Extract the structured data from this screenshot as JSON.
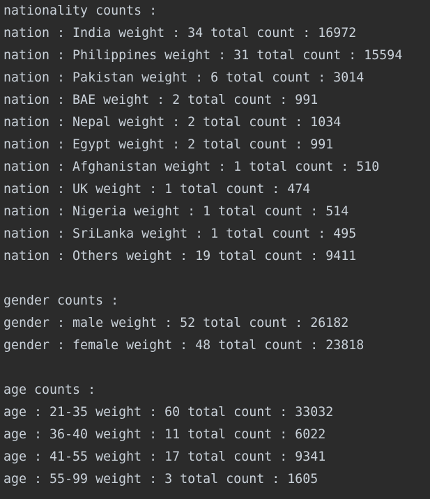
{
  "theme": {
    "background": "#2b2b2b",
    "text_color": "#c9d1d9"
  },
  "output": {
    "nationality_header": "nationality counts :",
    "nationality_lines": [
      "nation : India weight : 34 total count : 16972",
      "nation : Philippines weight : 31 total count : 15594",
      "nation : Pakistan weight : 6 total count : 3014",
      "nation : BAE weight : 2 total count : 991",
      "nation : Nepal weight : 2 total count : 1034",
      "nation : Egypt weight : 2 total count : 991",
      "nation : Afghanistan weight : 1 total count : 510",
      "nation : UK weight : 1 total count : 474",
      "nation : Nigeria weight : 1 total count : 514",
      "nation : SriLanka weight : 1 total count : 495",
      "nation : Others weight : 19 total count : 9411"
    ],
    "gender_header": "gender counts :",
    "gender_lines": [
      "gender : male weight : 52 total count : 26182",
      "gender : female weight : 48 total count : 23818"
    ],
    "age_header": "age counts :",
    "age_lines": [
      "age : 21-35 weight : 60 total count : 33032",
      "age : 36-40 weight : 11 total count : 6022",
      "age : 41-55 weight : 17 total count : 9341",
      "age : 55-99 weight : 3 total count : 1605"
    ]
  }
}
